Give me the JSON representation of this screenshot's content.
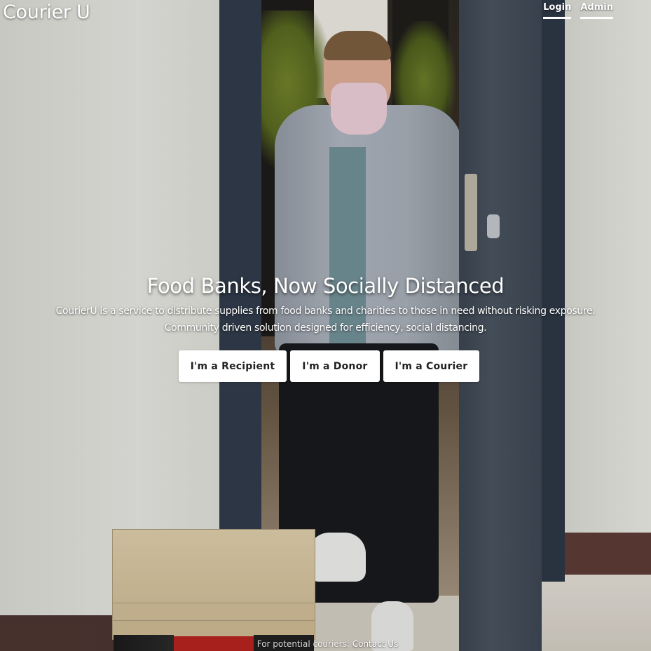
{
  "header": {
    "brand": "Courier U",
    "nav": [
      {
        "label": "Login"
      },
      {
        "label": "Admin"
      }
    ]
  },
  "hero": {
    "background": "video-still: masked man stepping through doorway past stacked pizza boxes",
    "title": "Food Banks, Now Socially Distanced",
    "description_line1": "CourierU is a service to distribute supplies from food banks and charities to those in need without risking exposure.",
    "description_line2": "Community driven solution designed for efficiency, social distancing.",
    "buttons": [
      {
        "label": "I'm a Recipient"
      },
      {
        "label": "I'm a Donor"
      },
      {
        "label": "I'm a Courier"
      }
    ]
  },
  "footer": {
    "prefix": "For potential couriers:",
    "link": "Contact Us"
  },
  "colors": {
    "text": "#ffffff",
    "button_bg": "#ffffff",
    "button_text": "#222222"
  }
}
